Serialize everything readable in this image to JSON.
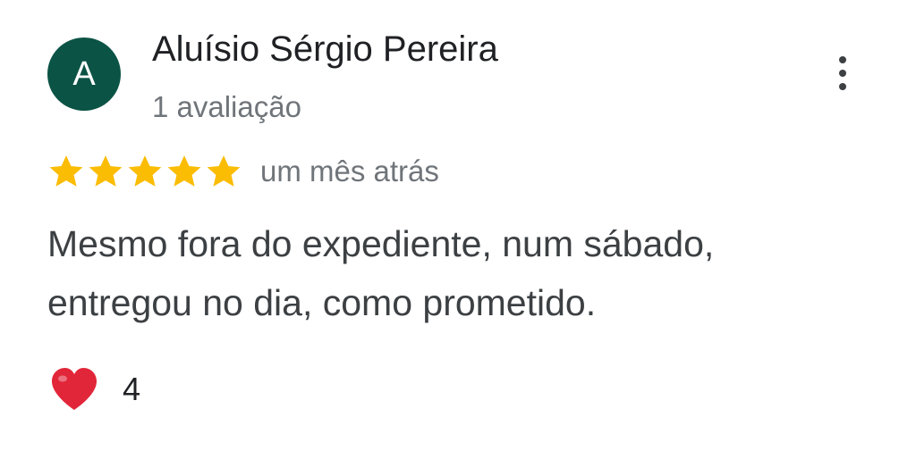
{
  "review": {
    "author": {
      "initial": "A",
      "name": "Aluísio Sérgio Pereira",
      "review_count": "1 avaliação",
      "avatar_color": "#0b5345"
    },
    "rating": {
      "stars": 5,
      "max_stars": 5,
      "star_color": "#fbbc04"
    },
    "time": "um mês atrás",
    "text": "Mesmo fora do expediente, num sábado, entregou no dia, como prometido.",
    "reaction": {
      "icon": "heart-icon",
      "color": "#e2263a",
      "count": "4"
    },
    "menu_icon": "more-vertical-icon"
  }
}
